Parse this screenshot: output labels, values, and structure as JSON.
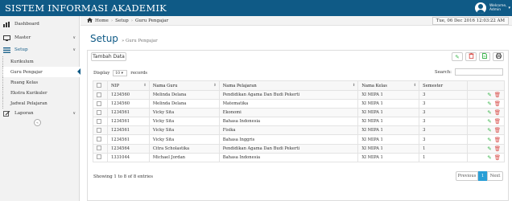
{
  "app": {
    "title": "SISTEM INFORMASI AKADEMIK"
  },
  "user": {
    "greeting": "Welcome,",
    "name": "Admin"
  },
  "sidebar": {
    "items": [
      {
        "label": "Dashboard"
      },
      {
        "label": "Master"
      },
      {
        "label": "Setup"
      },
      {
        "label": "Laporan"
      }
    ],
    "setup_children": [
      {
        "label": "Kurikulum"
      },
      {
        "label": "Guru Pengajar"
      },
      {
        "label": "Ruang Kelas"
      },
      {
        "label": "Ekstra Kurikuler"
      },
      {
        "label": "Jadwal Pelajaran"
      }
    ]
  },
  "breadcrumb": {
    "home": "Home",
    "setup": "Setup",
    "current": "Guru Pengajar"
  },
  "datetime": "Tue, 06 Dec 2016  12:03:22 AM",
  "page": {
    "title": "Setup",
    "subtitle": "» Guru Pengajar"
  },
  "toolbar": {
    "add_label": "Tambah Data"
  },
  "table_controls": {
    "display_label": "Display",
    "display_value": "10",
    "records_label": "records",
    "search_label": "Search:"
  },
  "table": {
    "columns": [
      "NIP",
      "Nama Guru",
      "Nama Pelajaran",
      "Nama Kelas",
      "Semester"
    ],
    "rows": [
      [
        "1234560",
        "Melinda Delana",
        "Pendidikan Agama Dan Budi Pekerti",
        "XI MIPA 1",
        "3"
      ],
      [
        "1234560",
        "Melinda Delana",
        "Matematika",
        "XI MIPA 1",
        "3"
      ],
      [
        "1234561",
        "Vicky Sita",
        "Ekonomi",
        "XI MIPA 1",
        "3"
      ],
      [
        "1234561",
        "Vicky Sita",
        "Bahasa Indonesia",
        "XI MIPA 1",
        "3"
      ],
      [
        "1234561",
        "Vicky Sita",
        "Fisika",
        "XI MIPA 1",
        "3"
      ],
      [
        "1234561",
        "Vicky Sita",
        "Bahasa Inggris",
        "XI MIPA 1",
        "3"
      ],
      [
        "1234564",
        "Citra Scholastika",
        "Pendidikan Agama Dan Budi Pekerti",
        "XI MIPA 1",
        "1"
      ],
      [
        "1331044",
        "Michael Jordan",
        "Bahasa Indonesia",
        "XI MIPA 1",
        "1"
      ]
    ]
  },
  "footer": {
    "showing": "Showing 1 to 8 of 8 entries",
    "prev": "Previous",
    "page": "1",
    "next": "Next"
  },
  "colors": {
    "topbar": "#0f5a86",
    "accent": "#2a9fd6",
    "edit": "#38b44a",
    "delete": "#d9534f"
  }
}
